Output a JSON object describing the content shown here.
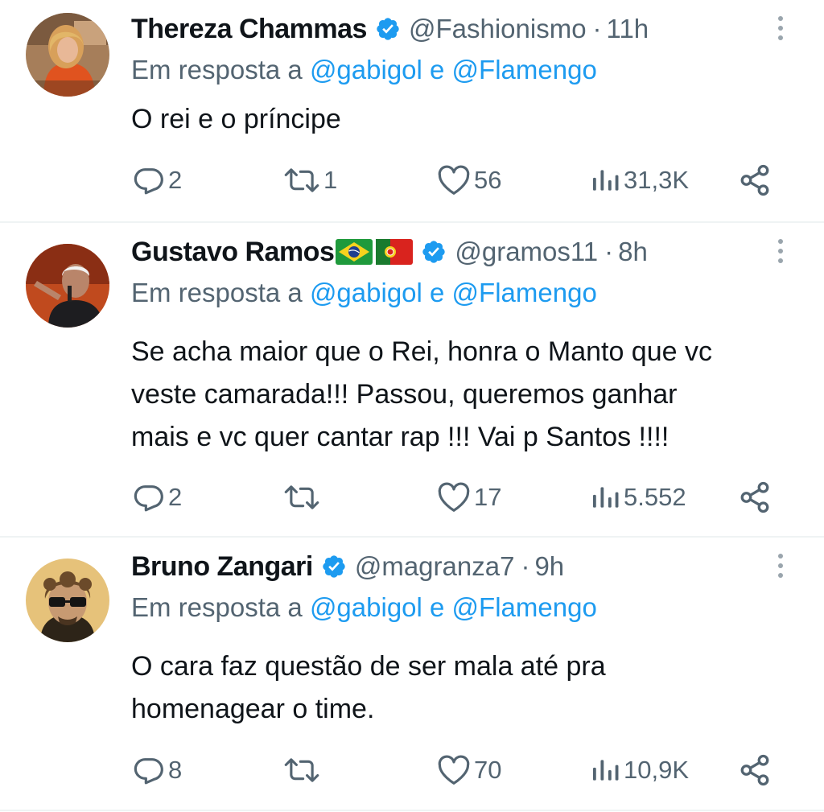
{
  "reply_prefix": "Em resposta a",
  "tweets": [
    {
      "name": "Thereza Chammas",
      "flags": [],
      "handle": "@Fashionismo",
      "sep": "·",
      "time": "11h",
      "reply_to": "@gabigol e @Flamengo",
      "text_lines": [
        "O rei e o príncipe"
      ],
      "replies": "2",
      "retweets": "1",
      "likes": "56",
      "views": "31,3K"
    },
    {
      "name": "Gustavo Ramos",
      "flags": [
        "flag-brazil",
        "flag-portugal"
      ],
      "handle": "@gramos11",
      "sep": "·",
      "time": "8h",
      "reply_to": "@gabigol e @Flamengo",
      "text_lines": [
        "Se acha maior que o Rei, honra o Manto que vc",
        "veste camarada!!! Passou, queremos ganhar",
        "mais e vc quer cantar rap !!! Vai p Santos !!!!"
      ],
      "replies": "2",
      "retweets": "",
      "likes": "17",
      "views": "5.552"
    },
    {
      "name": "Bruno Zangari",
      "flags": [],
      "handle": "@magranza7",
      "sep": "·",
      "time": "9h",
      "reply_to": "@gabigol e @Flamengo",
      "text_lines": [
        "O cara faz questão de ser mala até pra",
        "homenagear o time."
      ],
      "replies": "8",
      "retweets": "",
      "likes": "70",
      "views": "10,9K"
    }
  ],
  "colors": {
    "accent": "#1d9bf0",
    "secondary_text": "#536471",
    "divider": "#eff3f4"
  }
}
